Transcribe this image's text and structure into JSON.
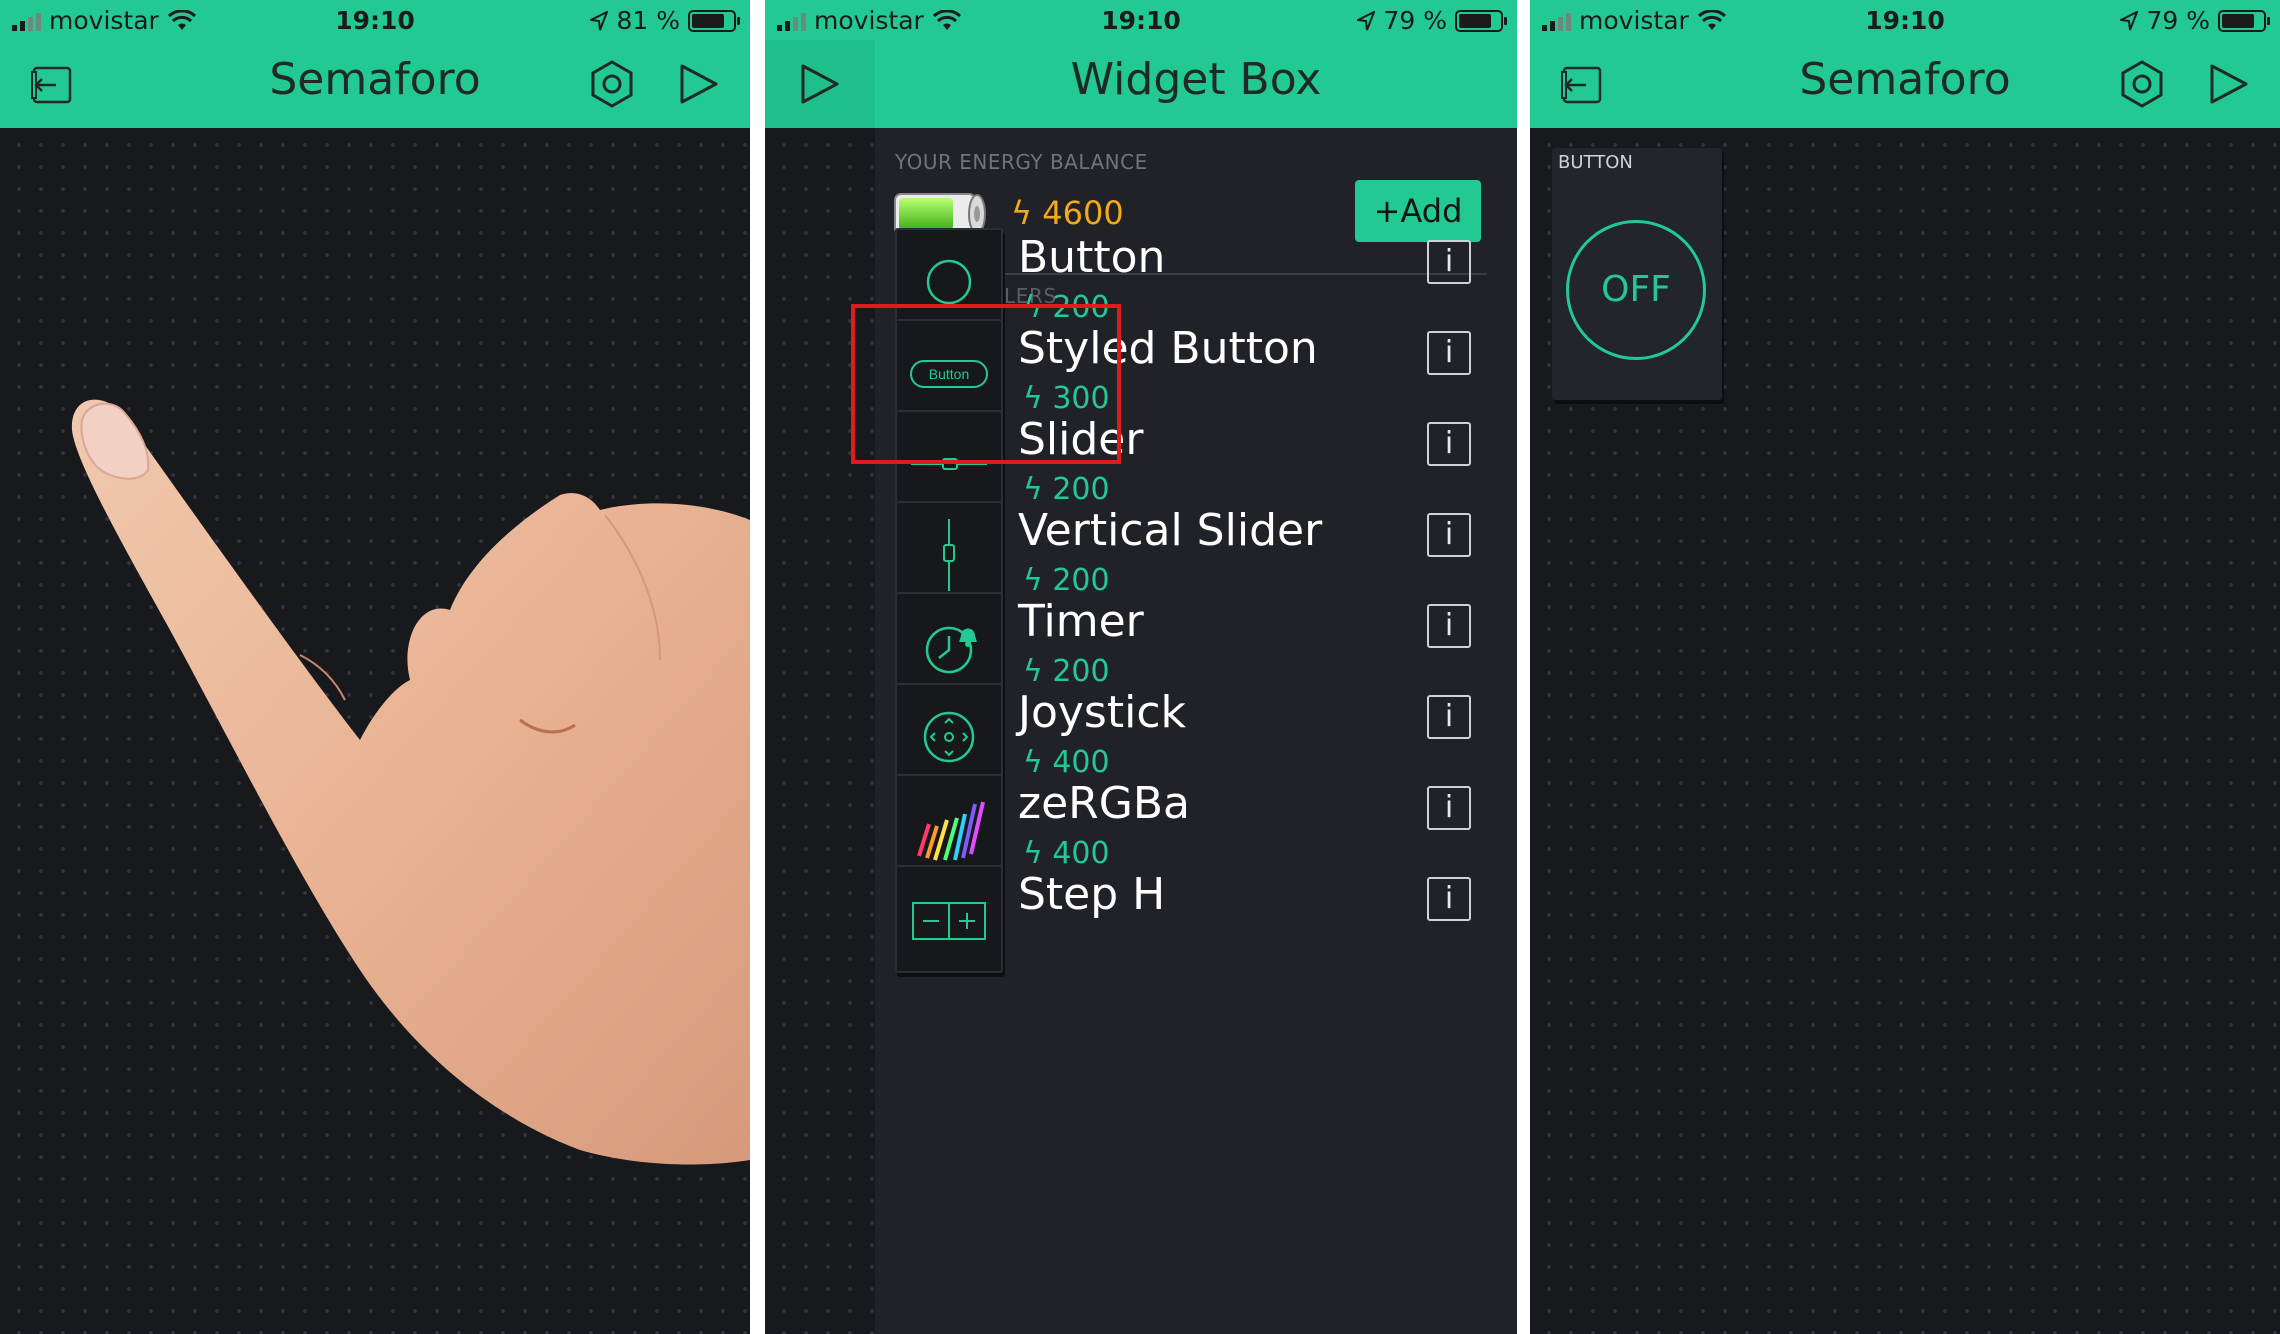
{
  "colors": {
    "accent": "#22c993",
    "background": "#18191d",
    "panel": "#202227",
    "energy": "#f2a91a",
    "highlight": "#e01b1b"
  },
  "screen1": {
    "status": {
      "carrier": "movistar",
      "time": "19:10",
      "battery": "81 %",
      "battery_level": 0.81
    },
    "header": {
      "title": "Semaforo",
      "left_icon": "exit-icon",
      "icons": [
        "settings-hex-icon",
        "play-icon"
      ]
    }
  },
  "screen2": {
    "status": {
      "carrier": "movistar",
      "time": "19:10",
      "battery": "79 %",
      "battery_level": 0.79
    },
    "header": {
      "title": "Widget Box",
      "left_icon": "play-icon"
    },
    "energy": {
      "label": "YOUR ENERGY BALANCE",
      "value": "4600",
      "add_label": "+Add"
    },
    "section": "CONTROLLERS",
    "widgets": [
      {
        "name": "Button",
        "price": "200",
        "icon": "circle-icon"
      },
      {
        "name": "Styled Button",
        "price": "300",
        "icon": "styled-button-icon",
        "icon_text": "Button"
      },
      {
        "name": "Slider",
        "price": "200",
        "icon": "slider-icon"
      },
      {
        "name": "Vertical Slider",
        "price": "200",
        "icon": "vertical-slider-icon"
      },
      {
        "name": "Timer",
        "price": "200",
        "icon": "timer-icon"
      },
      {
        "name": "Joystick",
        "price": "400",
        "icon": "joystick-icon"
      },
      {
        "name": "zeRGBa",
        "price": "400",
        "icon": "zebra-icon"
      },
      {
        "name": "Step H",
        "price": "",
        "icon": "step-h-icon"
      }
    ],
    "info_label": "i",
    "energy_glyph": "ϟ"
  },
  "screen3": {
    "status": {
      "carrier": "movistar",
      "time": "19:10",
      "battery": "79 %",
      "battery_level": 0.79
    },
    "header": {
      "title": "Semaforo",
      "left_icon": "exit-icon",
      "icons": [
        "settings-hex-icon",
        "play-icon"
      ]
    },
    "widget": {
      "label": "BUTTON",
      "state": "OFF"
    }
  }
}
